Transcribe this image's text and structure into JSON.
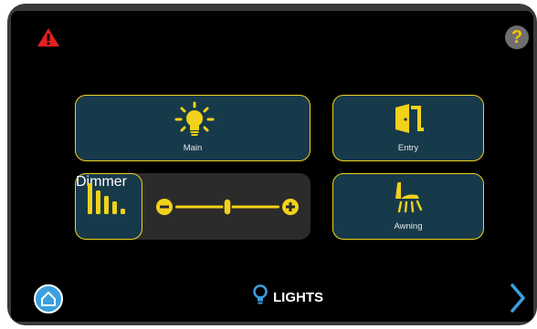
{
  "header": {
    "alert_icon": "warning-triangle-icon",
    "help_label": "?"
  },
  "tiles": {
    "main": {
      "label": "Main",
      "icon": "light-bulb-icon"
    },
    "entry": {
      "label": "Entry",
      "icon": "door-icon"
    },
    "dimmer": {
      "label": "Dimmer",
      "icon": "bars-icon"
    },
    "awning": {
      "label": "Awning",
      "icon": "awning-light-icon"
    }
  },
  "dimmer_slider": {
    "level": 0.5
  },
  "footer": {
    "page_title": "LIGHTS",
    "page_icon": "light-bulb-outline-icon",
    "home_icon": "home-icon",
    "next_icon": "chevron-right-icon"
  },
  "colors": {
    "accent": "#f2d21a",
    "tile_bg": "#173a4a",
    "screen_bg": "#000000",
    "alert": "#e02020",
    "home": "#3aa0e0"
  }
}
